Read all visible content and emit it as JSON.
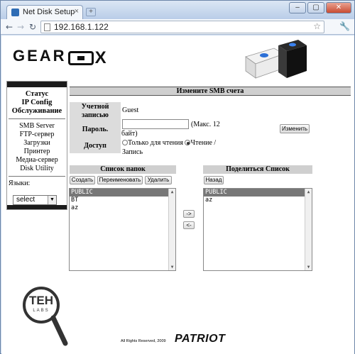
{
  "browser": {
    "tab_title": "Net Disk Setup",
    "tab_close": "×",
    "new_tab": "+",
    "url": "192.168.1.122",
    "window_buttons": [
      "–",
      "▢",
      "✕"
    ]
  },
  "logo": {
    "left": "GEAR",
    "x": "X"
  },
  "sidebar": {
    "groups": [
      [
        "Статус",
        "IP Config",
        "Обслуживание"
      ],
      [
        "SMB Server",
        "FTP-сервер",
        "Загрузки",
        "Принтер",
        "Медиа-сервер",
        "Disk Utility"
      ]
    ],
    "language_label": "Языки:",
    "language_value": "select"
  },
  "smb": {
    "header": "Измените SMB счета",
    "account_label": "Учетной записью",
    "account_value": "Guest",
    "password_label": "Пароль.",
    "password_hint": "(Макс. 12 байт)",
    "access_label": "Доступ",
    "access_options": [
      "Только для чтения",
      "Чтение / Запись"
    ],
    "access_selected": 1,
    "change_button": "Изменить"
  },
  "folders": {
    "header": "Список папок",
    "buttons": [
      "Создать",
      "Переименовать",
      "Удалить"
    ],
    "items": [
      "PUBLIC",
      "BT",
      "az"
    ],
    "selected": 0
  },
  "transfer": {
    "add": "->",
    "remove": "<-"
  },
  "share": {
    "header": "Поделиться Список",
    "back_button": "Назад",
    "items": [
      "PUBLIC",
      "az"
    ],
    "selected": 0
  },
  "watermark": {
    "top": "TEH",
    "bottom": "LABS"
  },
  "footer": {
    "copyright": "All Rights Reserved, 2009",
    "brand": "PATRIOT"
  }
}
